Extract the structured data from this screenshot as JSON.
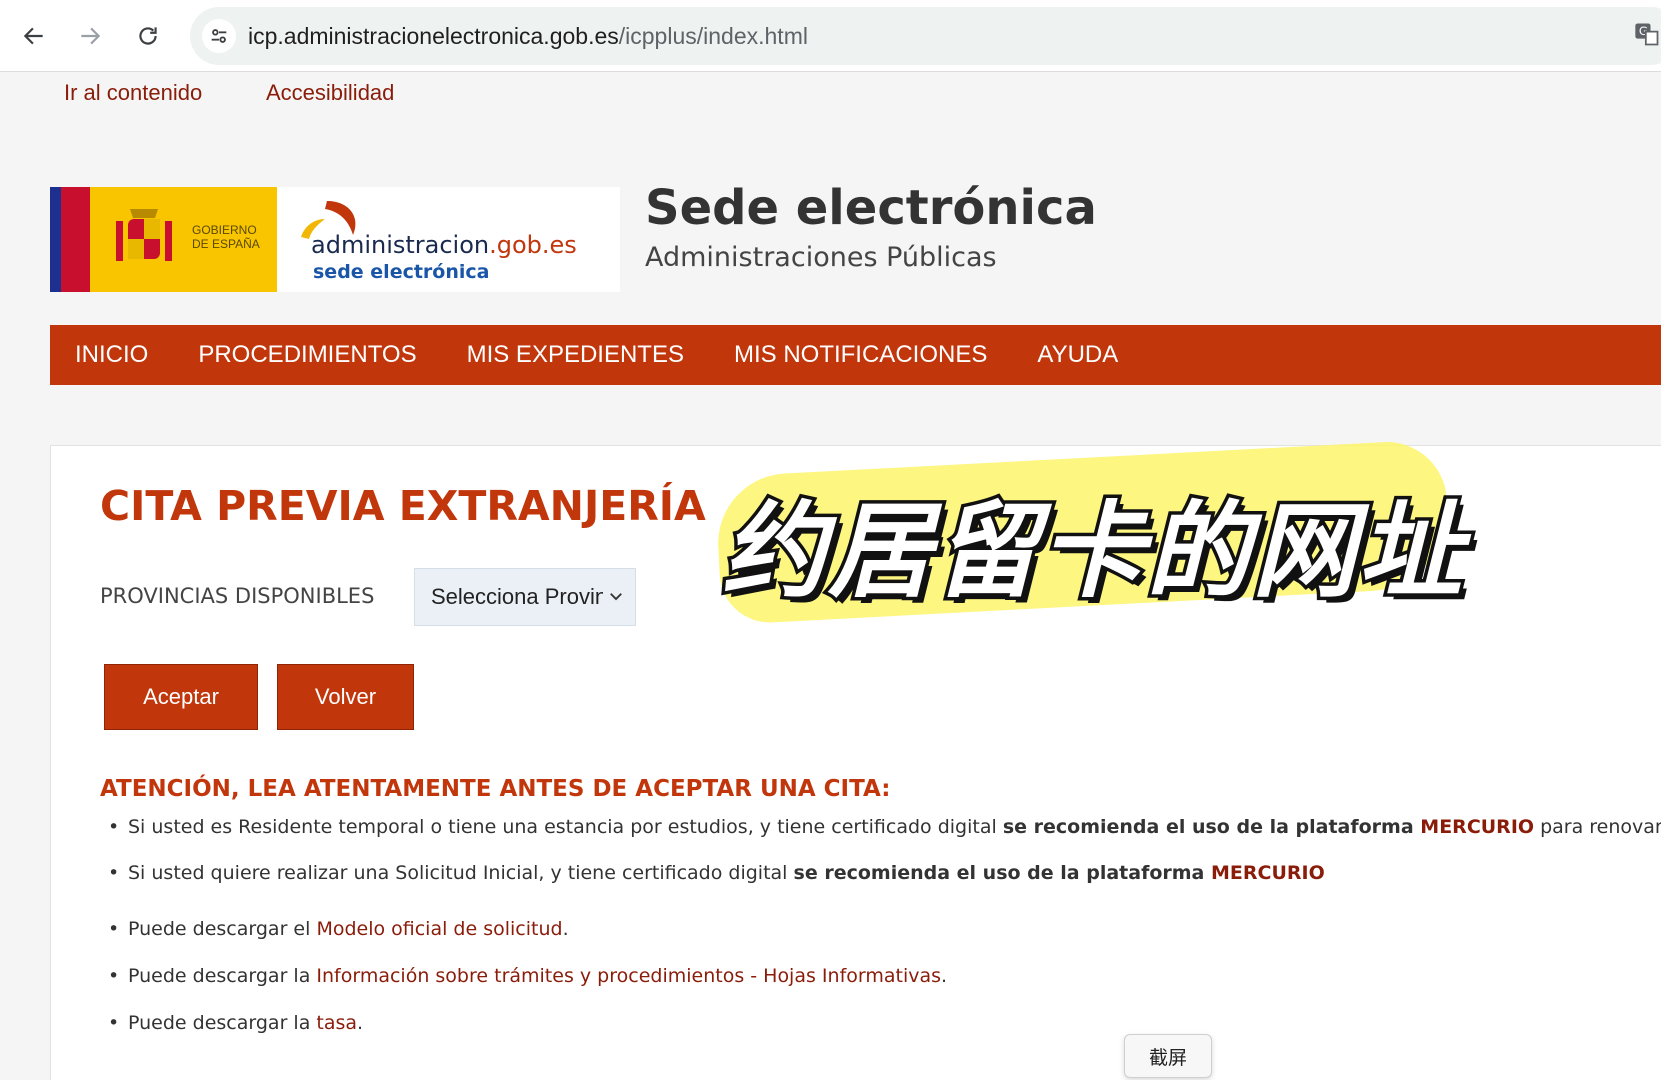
{
  "browser": {
    "url_host": "icp.administracionelectronica.gob.es",
    "url_path": "/icpplus/index.html"
  },
  "skip_links": {
    "content": "Ir al contenido",
    "accessibility": "Accesibilidad"
  },
  "header": {
    "gov_logo_text_line1": "GOBIERNO",
    "gov_logo_text_line2": "DE ESPAÑA",
    "admin_logo_name": "administracion",
    "admin_logo_domain": ".gob.es",
    "admin_logo_sub": "sede electrónica",
    "site_title": "Sede electrónica",
    "site_subtitle": "Administraciones Públicas"
  },
  "main_nav": {
    "items": [
      {
        "label": "INICIO"
      },
      {
        "label": "PROCEDIMIENTOS"
      },
      {
        "label": "MIS EXPEDIENTES"
      },
      {
        "label": "MIS NOTIFICACIONES"
      },
      {
        "label": "AYUDA"
      }
    ]
  },
  "content": {
    "title": "CITA PREVIA EXTRANJERÍA",
    "provinces_label": "PROVINCIAS DISPONIBLES",
    "provinces_select_value": "Selecciona Provincia",
    "accept_button": "Aceptar",
    "back_button": "Volver",
    "notice_title": "ATENCIÓN, LEA ATENTAMENTE ANTES DE ACEPTAR UNA CITA:",
    "notices": [
      {
        "text_a": "Si usted es Residente temporal o tiene una estancia por estudios, y tiene certificado digital ",
        "bold": "se recomienda el uso de la plataforma ",
        "link": "MERCURIO",
        "text_b": " para renovar."
      },
      {
        "text_a": "Si usted quiere realizar una Solicitud Inicial, y tiene certificado digital ",
        "bold": "se recomienda el uso de la plataforma ",
        "link": "MERCURIO"
      },
      {
        "text_a": "Puede descargar el ",
        "link": "Modelo oficial de solicitud",
        "text_b": "."
      },
      {
        "text_a": "Puede descargar la ",
        "link": "Información sobre trámites y procedimientos - Hojas Informativas",
        "text_b": "."
      },
      {
        "text_a": "Puede descargar la ",
        "link": "tasa",
        "text_b": "."
      }
    ]
  },
  "overlay": {
    "caption": "约居留卡的网址",
    "screenshot_tooltip": "截屏"
  },
  "colors": {
    "brand_red": "#c2360c",
    "link_red": "#8a1c0a",
    "highlight_yellow": "#fdf56a"
  }
}
